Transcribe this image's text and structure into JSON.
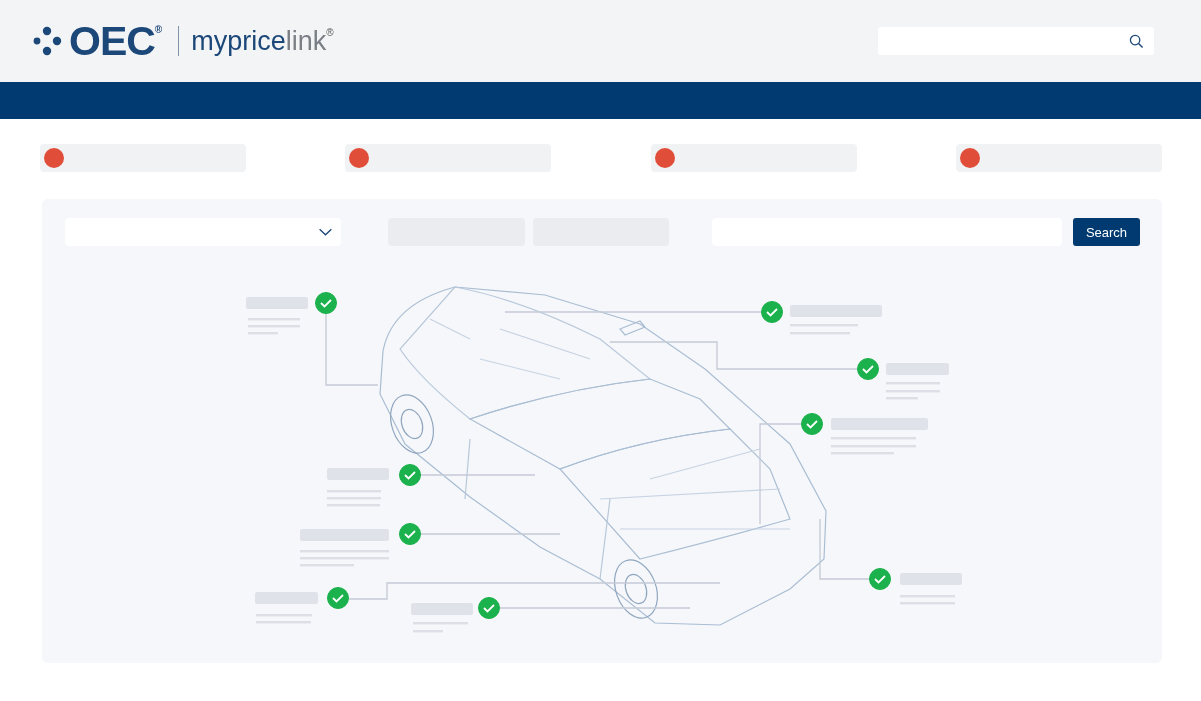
{
  "logo": {
    "company": "OEC",
    "company_mark": "®",
    "product": "myprice",
    "product_suffix": "link",
    "product_mark": "®"
  },
  "status_chips": [
    {
      "color": "#e04e39"
    },
    {
      "color": "#e04e39"
    },
    {
      "color": "#e04e39"
    },
    {
      "color": "#e04e39"
    }
  ],
  "search_button": "Search",
  "callouts": [
    {
      "checked": true
    },
    {
      "checked": true
    },
    {
      "checked": true
    },
    {
      "checked": true
    },
    {
      "checked": true
    },
    {
      "checked": true
    },
    {
      "checked": true
    },
    {
      "checked": true
    },
    {
      "checked": true
    }
  ]
}
